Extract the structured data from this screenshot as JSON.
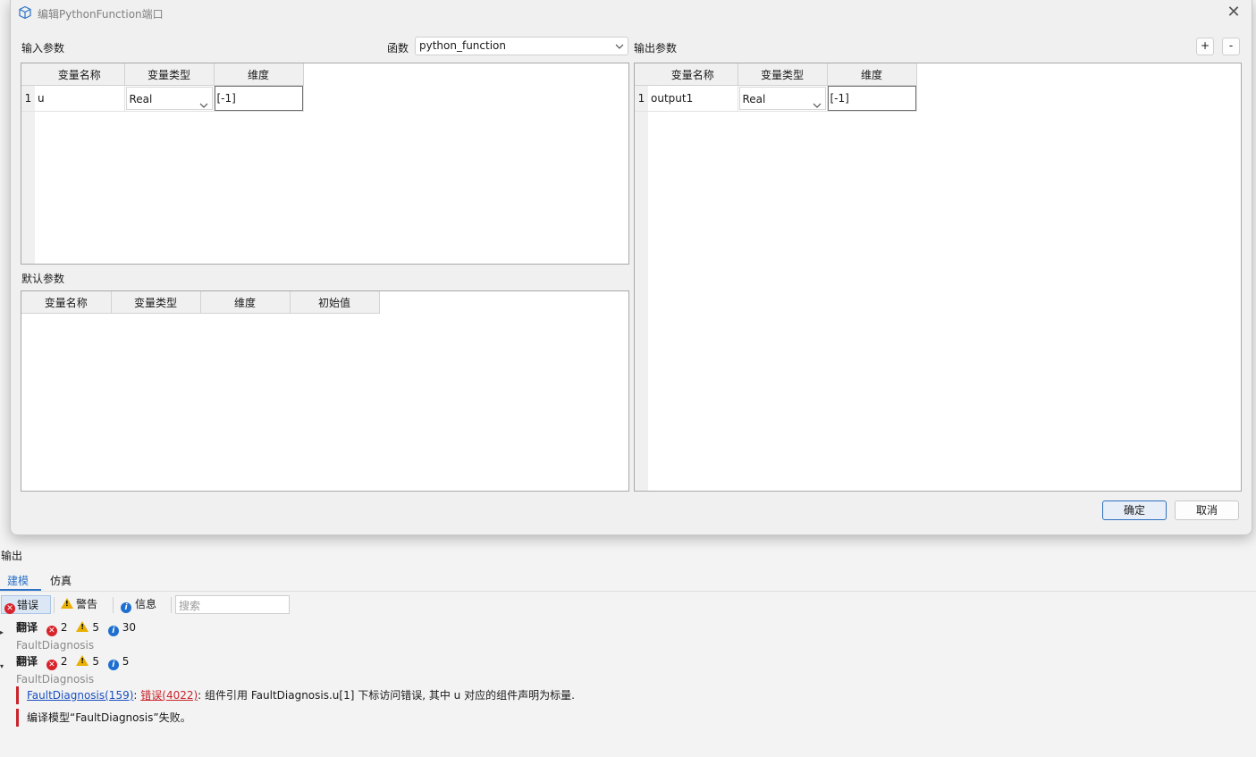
{
  "dialog": {
    "title": "编辑PythonFunction端口",
    "close_glyph": "✕",
    "icon": "cube-icon"
  },
  "inputs": {
    "label": "输入参数",
    "columns": [
      "变量名称",
      "变量类型",
      "维度"
    ],
    "rows": [
      {
        "index": "1",
        "name": "u",
        "type": "Real",
        "dim": "[-1]"
      }
    ]
  },
  "function": {
    "label": "函数",
    "value": "python_function"
  },
  "outputs": {
    "label": "输出参数",
    "add_label": "+",
    "remove_label": "-",
    "columns": [
      "变量名称",
      "变量类型",
      "维度"
    ],
    "rows": [
      {
        "index": "1",
        "name": "output1",
        "type": "Real",
        "dim": "[-1]"
      }
    ]
  },
  "defaults": {
    "label": "默认参数",
    "columns": [
      "变量名称",
      "变量类型",
      "维度",
      "初始值"
    ]
  },
  "buttons": {
    "ok": "确定",
    "cancel": "取消"
  },
  "output_panel": {
    "title": "输出",
    "tabs": [
      {
        "label": "建模",
        "active": true
      },
      {
        "label": "仿真",
        "active": false
      }
    ],
    "filters": {
      "error": "错误",
      "warning": "警告",
      "info": "信息"
    },
    "search_placeholder": "搜索",
    "groups": [
      {
        "title": "翻译",
        "errors": "2",
        "warnings": "5",
        "infos": "30",
        "subtitle": "FaultDiagnosis",
        "expanded": false
      },
      {
        "title": "翻译",
        "errors": "2",
        "warnings": "5",
        "infos": "5",
        "subtitle": "FaultDiagnosis",
        "expanded": true
      }
    ],
    "messages": [
      {
        "link": "FaultDiagnosis(159)",
        "sep1": ": ",
        "code": "错误(4022)",
        "text": ": 组件引用 FaultDiagnosis.u[1] 下标访问错误, 其中 u 对应的组件声明为标量."
      },
      {
        "text": "编译模型“FaultDiagnosis”失败。"
      }
    ]
  },
  "colors": {
    "accent": "#2b72c7",
    "error": "#d8232a",
    "warning": "#e8b000",
    "info": "#1e6fd0"
  }
}
